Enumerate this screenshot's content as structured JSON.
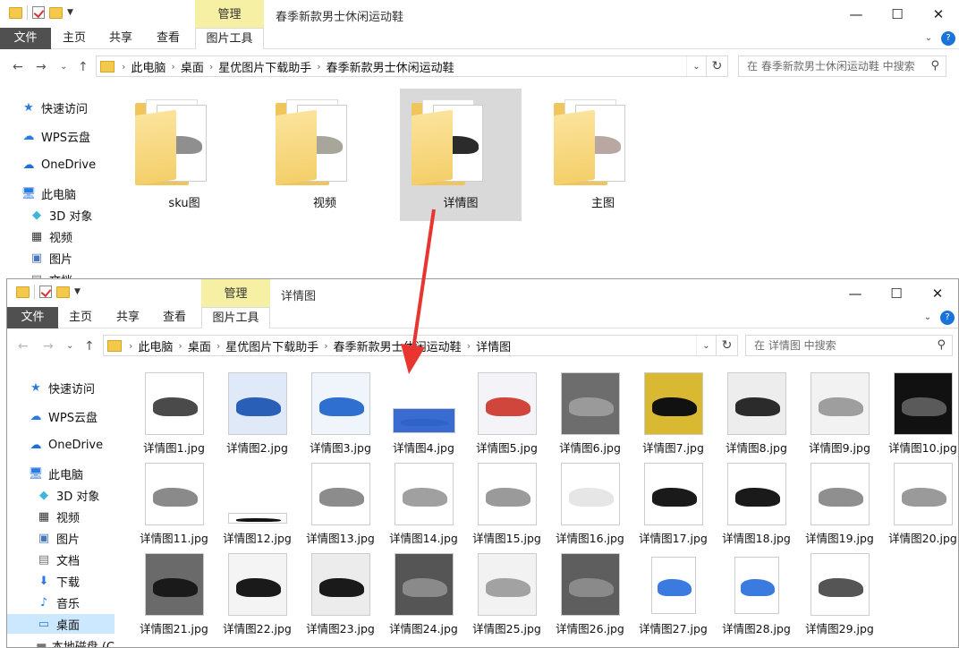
{
  "window_top": {
    "manage_tab": "管理",
    "title": "春季新款男士休闲运动鞋",
    "tabs": [
      "文件",
      "主页",
      "共享",
      "查看",
      "图片工具"
    ],
    "breadcrumb": [
      "此电脑",
      "桌面",
      "星优图片下载助手",
      "春季新款男士休闲运动鞋"
    ],
    "search_placeholder": "在 春季新款男士休闲运动鞋 中搜索",
    "nav": [
      "快速访问",
      "WPS云盘",
      "OneDrive",
      "此电脑",
      "3D 对象",
      "视频",
      "图片",
      "文档"
    ],
    "folders": [
      {
        "name": "sku图",
        "theme": "#8f8f8f"
      },
      {
        "name": "视频",
        "theme": "#a8a69a"
      },
      {
        "name": "详情图",
        "theme": "#2b2b2b"
      },
      {
        "name": "主图",
        "theme": "#b9a7a2"
      }
    ]
  },
  "window_bottom": {
    "manage_tab": "管理",
    "title": "详情图",
    "tabs": [
      "文件",
      "主页",
      "共享",
      "查看",
      "图片工具"
    ],
    "breadcrumb": [
      "此电脑",
      "桌面",
      "星优图片下载助手",
      "春季新款男士休闲运动鞋",
      "详情图"
    ],
    "search_placeholder": "在 详情图 中搜索",
    "nav": [
      "快速访问",
      "WPS云盘",
      "OneDrive",
      "此电脑",
      "3D 对象",
      "视频",
      "图片",
      "文档",
      "下载",
      "音乐",
      "桌面",
      "本地磁盘 (C"
    ],
    "files": [
      {
        "name": "详情图1.jpg",
        "shoe": "#4a4a4a",
        "bg": "#ffffff"
      },
      {
        "name": "详情图2.jpg",
        "shoe": "#2a5fb8",
        "bg": "#dfe9f7"
      },
      {
        "name": "详情图3.jpg",
        "shoe": "#2f6fd0",
        "bg": "#f0f4fb"
      },
      {
        "name": "详情图4.jpg",
        "shoe": "#2f63c6",
        "bg": "#3a6bd0"
      },
      {
        "name": "详情图5.jpg",
        "shoe": "#d0463c",
        "bg": "#f4f4f8"
      },
      {
        "name": "详情图6.jpg",
        "shoe": "#9a9a9a",
        "bg": "#6d6d6d"
      },
      {
        "name": "详情图7.jpg",
        "shoe": "#111111",
        "bg": "#d9b832"
      },
      {
        "name": "详情图8.jpg",
        "shoe": "#2b2b2b",
        "bg": "#ededed"
      },
      {
        "name": "详情图9.jpg",
        "shoe": "#9e9e9e",
        "bg": "#f2f2f2"
      },
      {
        "name": "详情图10.jpg",
        "shoe": "#5a5a5a",
        "bg": "#111111"
      },
      {
        "name": "详情图11.jpg",
        "shoe": "#8a8a8a",
        "bg": "#ffffff"
      },
      {
        "name": "详情图12.jpg",
        "shoe": "#111111",
        "bg": "#ffffff"
      },
      {
        "name": "详情图13.jpg",
        "shoe": "#8c8c8c",
        "bg": "#ffffff"
      },
      {
        "name": "详情图14.jpg",
        "shoe": "#a0a0a0",
        "bg": "#ffffff"
      },
      {
        "name": "详情图15.jpg",
        "shoe": "#9a9a9a",
        "bg": "#ffffff"
      },
      {
        "name": "详情图16.jpg",
        "shoe": "#e6e6e6",
        "bg": "#ffffff"
      },
      {
        "name": "详情图17.jpg",
        "shoe": "#1a1a1a",
        "bg": "#ffffff"
      },
      {
        "name": "详情图18.jpg",
        "shoe": "#1a1a1a",
        "bg": "#ffffff"
      },
      {
        "name": "详情图19.jpg",
        "shoe": "#8f8f8f",
        "bg": "#ffffff"
      },
      {
        "name": "详情图20.jpg",
        "shoe": "#9a9a9a",
        "bg": "#ffffff"
      },
      {
        "name": "详情图21.jpg",
        "shoe": "#1a1a1a",
        "bg": "#6a6a6a"
      },
      {
        "name": "详情图22.jpg",
        "shoe": "#1a1a1a",
        "bg": "#f4f4f4"
      },
      {
        "name": "详情图23.jpg",
        "shoe": "#1a1a1a",
        "bg": "#ececec"
      },
      {
        "name": "详情图24.jpg",
        "shoe": "#8a8a8a",
        "bg": "#555555"
      },
      {
        "name": "详情图25.jpg",
        "shoe": "#a2a2a2",
        "bg": "#f2f2f2"
      },
      {
        "name": "详情图26.jpg",
        "shoe": "#8a8a8a",
        "bg": "#5e5e5e"
      },
      {
        "name": "详情图27.jpg",
        "shoe": "#3b7be0",
        "bg": "#ffffff"
      },
      {
        "name": "详情图28.jpg",
        "shoe": "#3b7be0",
        "bg": "#ffffff"
      },
      {
        "name": "详情图29.jpg",
        "shoe": "#555555",
        "bg": "#ffffff"
      }
    ]
  },
  "colors": {
    "arrow": "#e8352f",
    "manage_bg": "#f6f0a4",
    "selected_nav": "#cce8ff",
    "help_icon": "#1a73d9"
  }
}
